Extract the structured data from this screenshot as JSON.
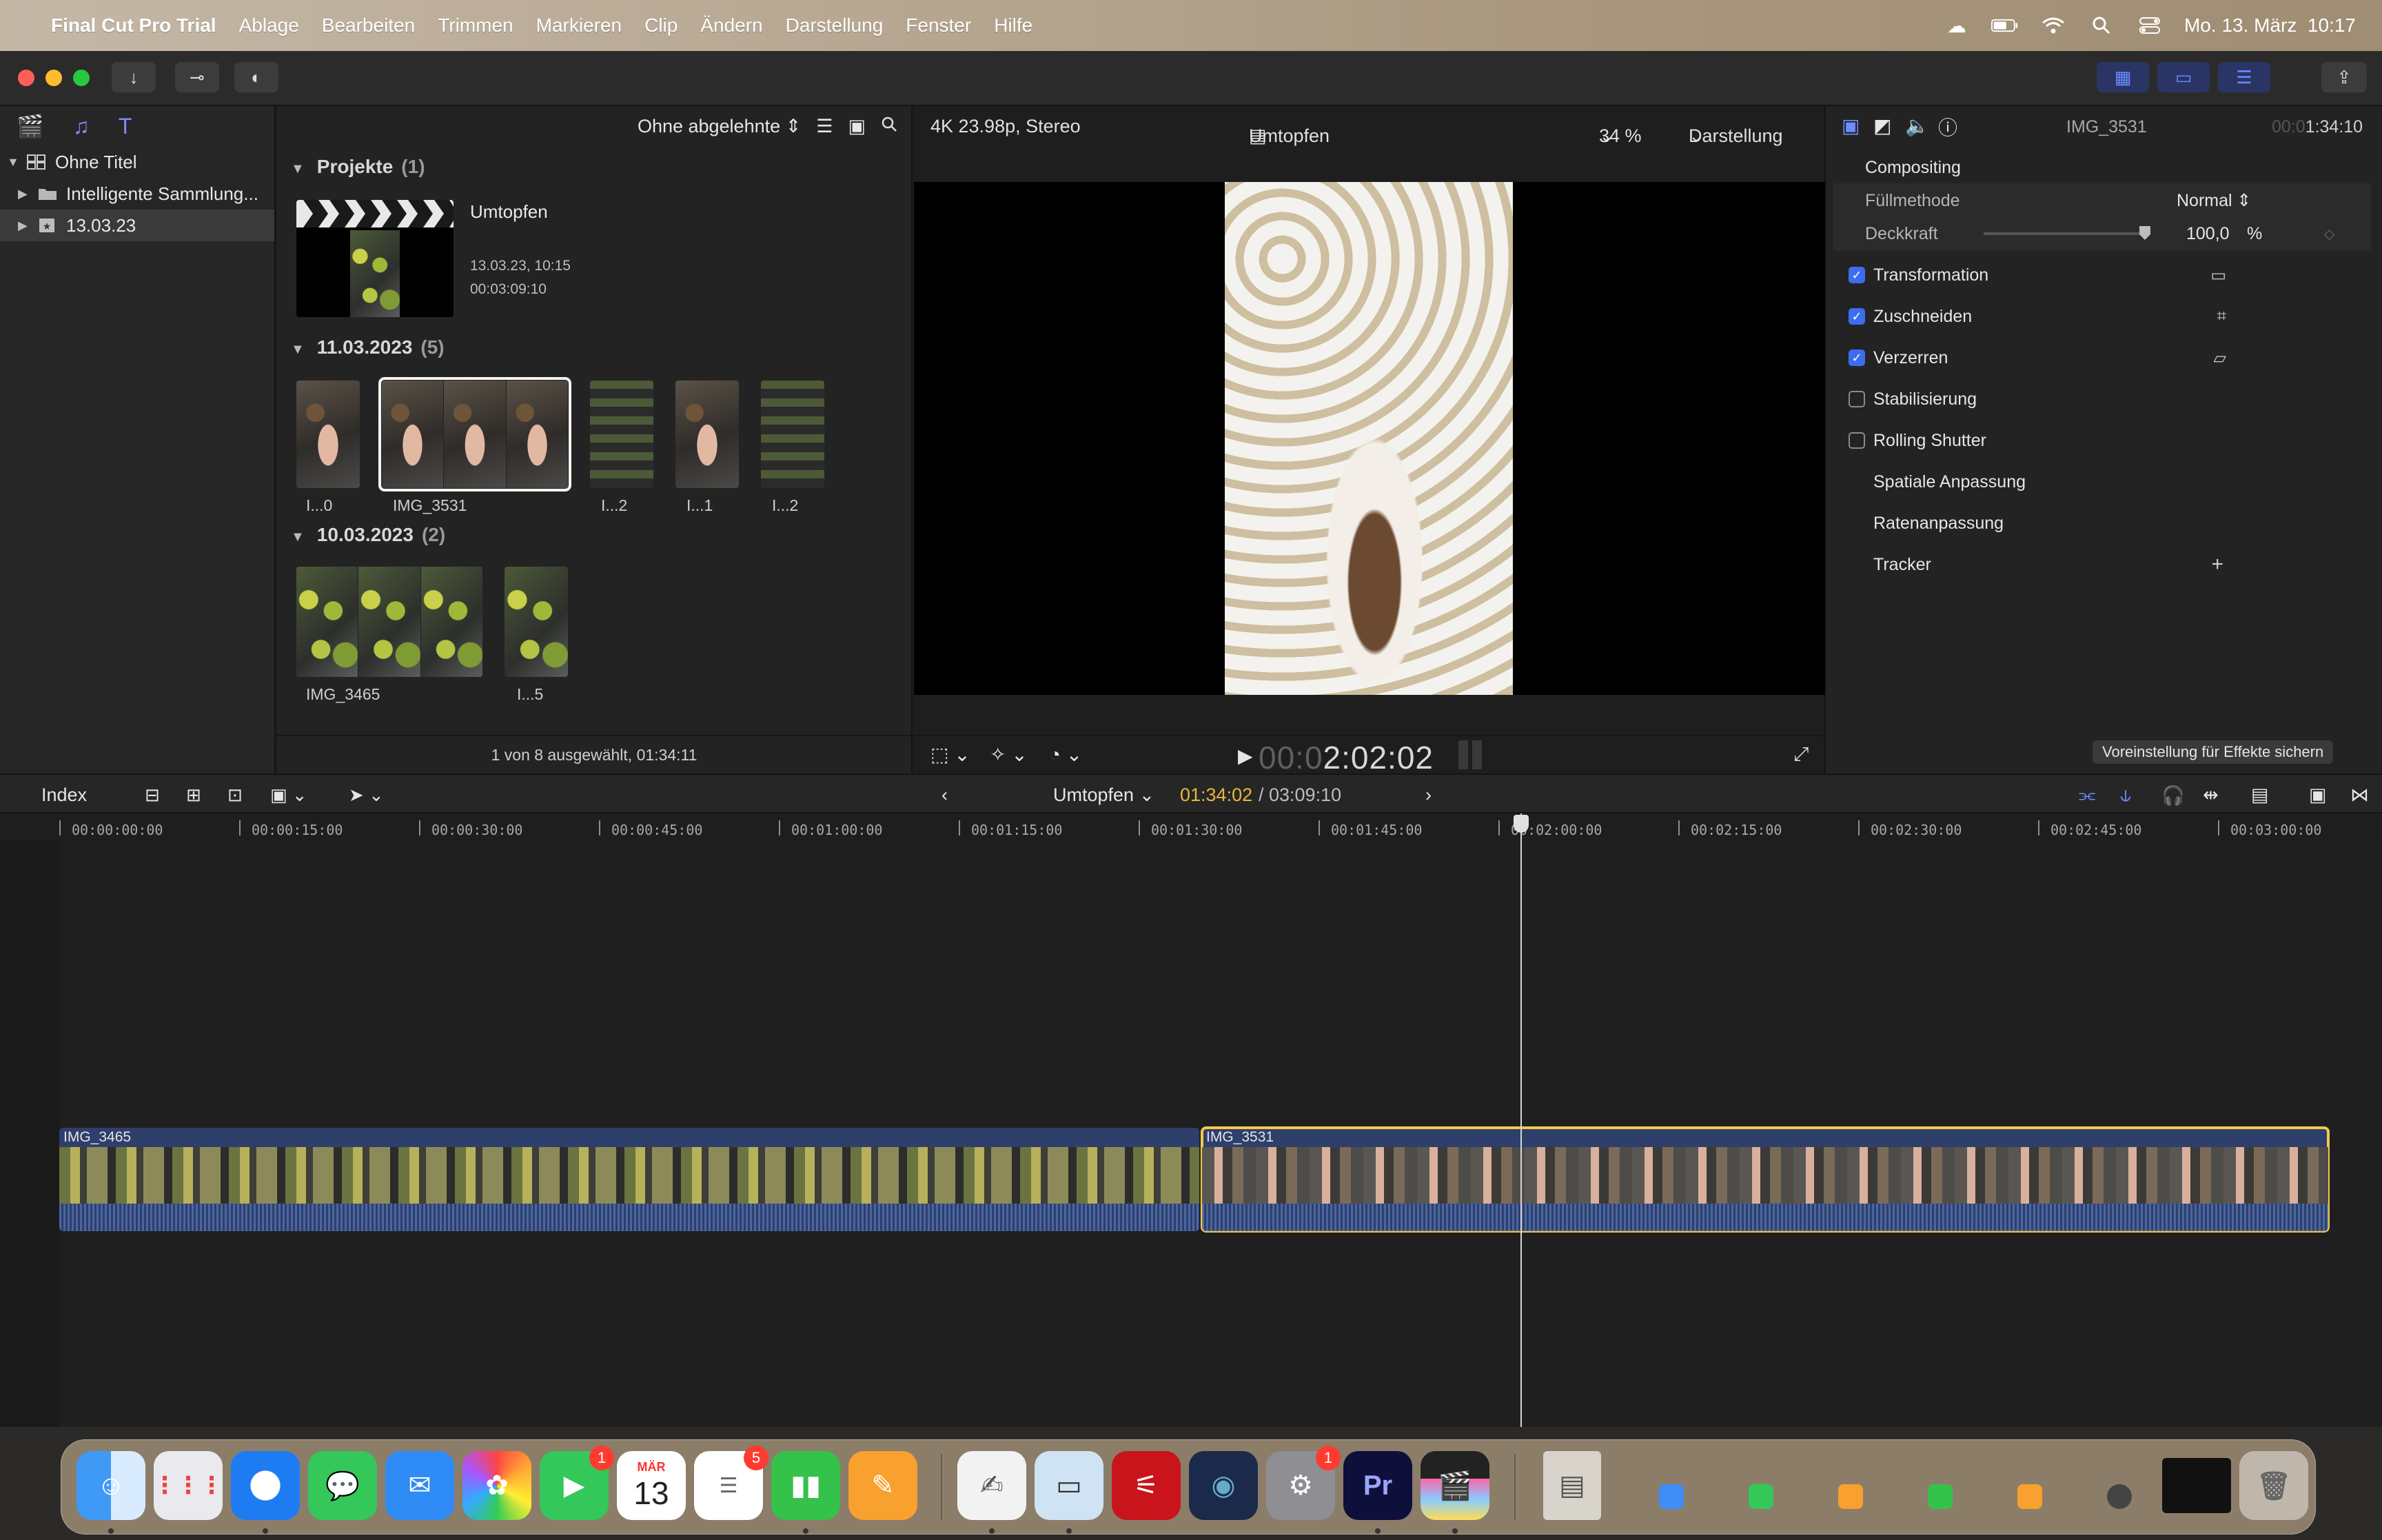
{
  "menubar": {
    "app_name": "Final Cut Pro Trial",
    "items": [
      "Ablage",
      "Bearbeiten",
      "Trimmen",
      "Markieren",
      "Clip",
      "Ändern",
      "Darstellung",
      "Fenster",
      "Hilfe"
    ],
    "clock": "Mo. 13. März  10:17"
  },
  "library": {
    "items": [
      {
        "label": "Ohne Titel"
      },
      {
        "label": "Intelligente Sammlung..."
      },
      {
        "label": "13.03.23"
      }
    ]
  },
  "browser": {
    "filter_label": "Ohne abgelehnte",
    "projects": {
      "title": "Projekte",
      "count": "(1)",
      "project_name": "Umtopfen",
      "date": "13.03.23, 10:15",
      "duration": "00:03:09:10"
    },
    "events": [
      {
        "title": "11.03.2023",
        "count": "(5)",
        "clips": [
          "I...0",
          "IMG_3531",
          "I...2",
          "I...1",
          "I...2"
        ]
      },
      {
        "title": "10.03.2023",
        "count": "(2)",
        "clips": [
          "IMG_3465",
          "I...5"
        ]
      }
    ],
    "footer": "1 von 8 ausgewählt, 01:34:11"
  },
  "viewer": {
    "format": "4K 23.98p, Stereo",
    "project_title": "Umtopfen",
    "zoom": "34 %",
    "view_menu": "Darstellung",
    "timecode_dim": "00:0",
    "timecode": "2:02:02"
  },
  "inspector": {
    "clip_name": "IMG_3531",
    "duration_dim": "00:0",
    "duration": "1:34:10",
    "compositing": "Compositing",
    "blend_mode_label": "Füllmethode",
    "blend_mode_value": "Normal",
    "opacity_label": "Deckkraft",
    "opacity_value": "100,0",
    "opacity_unit": "%",
    "sections": [
      {
        "label": "Transformation",
        "checked": true
      },
      {
        "label": "Zuschneiden",
        "checked": true
      },
      {
        "label": "Verzerren",
        "checked": true
      },
      {
        "label": "Stabilisierung",
        "checked": false
      },
      {
        "label": "Rolling Shutter",
        "checked": false
      },
      {
        "label": "Spatiale Anpassung"
      },
      {
        "label": "Ratenanpassung"
      },
      {
        "label": "Tracker"
      }
    ],
    "save_preset": "Voreinstellung für Effekte sichern"
  },
  "timeline": {
    "index_label": "Index",
    "project_name": "Umtopfen",
    "position": "01:34:02",
    "total": "/ 03:09:10",
    "ruler": [
      "00:00:00:00",
      "00:00:15:00",
      "00:00:30:00",
      "00:00:45:00",
      "00:01:00:00",
      "00:01:15:00",
      "00:01:30:00",
      "00:01:45:00",
      "00:02:00:00",
      "00:02:15:00",
      "00:02:30:00",
      "00:02:45:00",
      "00:03:00:00"
    ],
    "clips": [
      {
        "name": "IMG_3465",
        "selected": false
      },
      {
        "name": "IMG_3531",
        "selected": true
      }
    ]
  },
  "dock": {
    "calendar_month": "MÄR",
    "calendar_day": "13",
    "badges": {
      "facetime": "1",
      "reminders": "5",
      "settings": "1"
    },
    "premiere_label": "Pr"
  },
  "colors": {
    "accent": "#3c6df0",
    "selection_yellow": "#f2c94c",
    "timecode_yellow": "#e8b83a",
    "clip_blue": "#2e3f6b"
  }
}
